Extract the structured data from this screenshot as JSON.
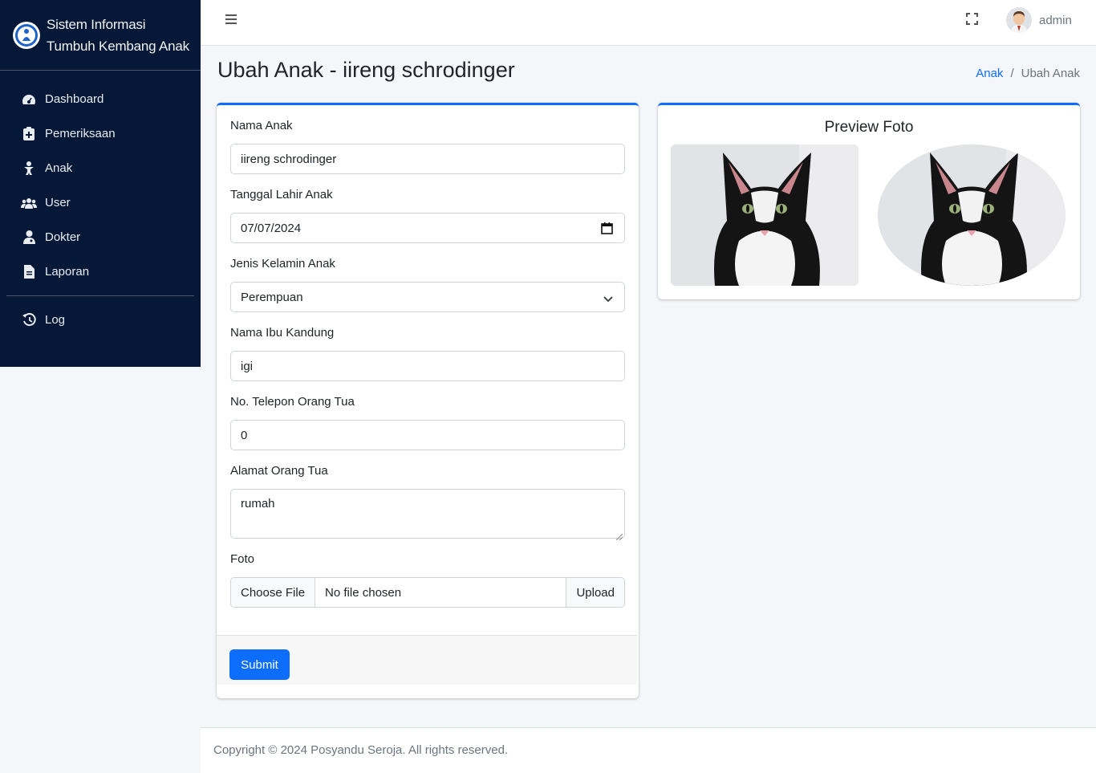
{
  "app": {
    "brand_line1": "Sistem Informasi",
    "brand_line2": "Tumbuh Kembang Anak"
  },
  "sidebar": {
    "items": [
      {
        "label": "Dashboard",
        "icon": "tachometer-icon"
      },
      {
        "label": "Pemeriksaan",
        "icon": "clipboard-icon"
      },
      {
        "label": "Anak",
        "icon": "child-icon"
      },
      {
        "label": "User",
        "icon": "users-icon"
      },
      {
        "label": "Dokter",
        "icon": "doctor-icon"
      },
      {
        "label": "Laporan",
        "icon": "file-icon"
      }
    ],
    "secondary": [
      {
        "label": "Log",
        "icon": "history-icon"
      }
    ]
  },
  "navbar": {
    "username": "admin"
  },
  "page": {
    "title": "Ubah Anak - iireng schrodinger",
    "breadcrumb": [
      "Anak",
      "Ubah Anak"
    ],
    "breadcrumb_separator": "/"
  },
  "form": {
    "nama_anak_label": "Nama Anak",
    "nama_anak_value": "iireng schrodinger",
    "tanggal_lahir_label": "Tanggal Lahir Anak",
    "tanggal_lahir_value": "07/07/2024",
    "jenis_kelamin_label": "Jenis Kelamin Anak",
    "jenis_kelamin_value": "Perempuan",
    "nama_ibu_label": "Nama Ibu Kandung",
    "nama_ibu_value": "igi",
    "telepon_label": "No. Telepon Orang Tua",
    "telepon_value": "0",
    "alamat_label": "Alamat Orang Tua",
    "alamat_value": "rumah",
    "foto_label": "Foto",
    "choose_file_label": "Choose File",
    "no_file_label": "No file chosen",
    "upload_label": "Upload",
    "submit_label": "Submit"
  },
  "preview": {
    "title": "Preview Foto"
  },
  "footer": {
    "text": "Copyright © 2024 Posyandu Seroja. All rights reserved."
  },
  "colors": {
    "sidebar_bg": "#051838",
    "primary": "#0d6efd",
    "content_bg": "#f4f6f9"
  }
}
